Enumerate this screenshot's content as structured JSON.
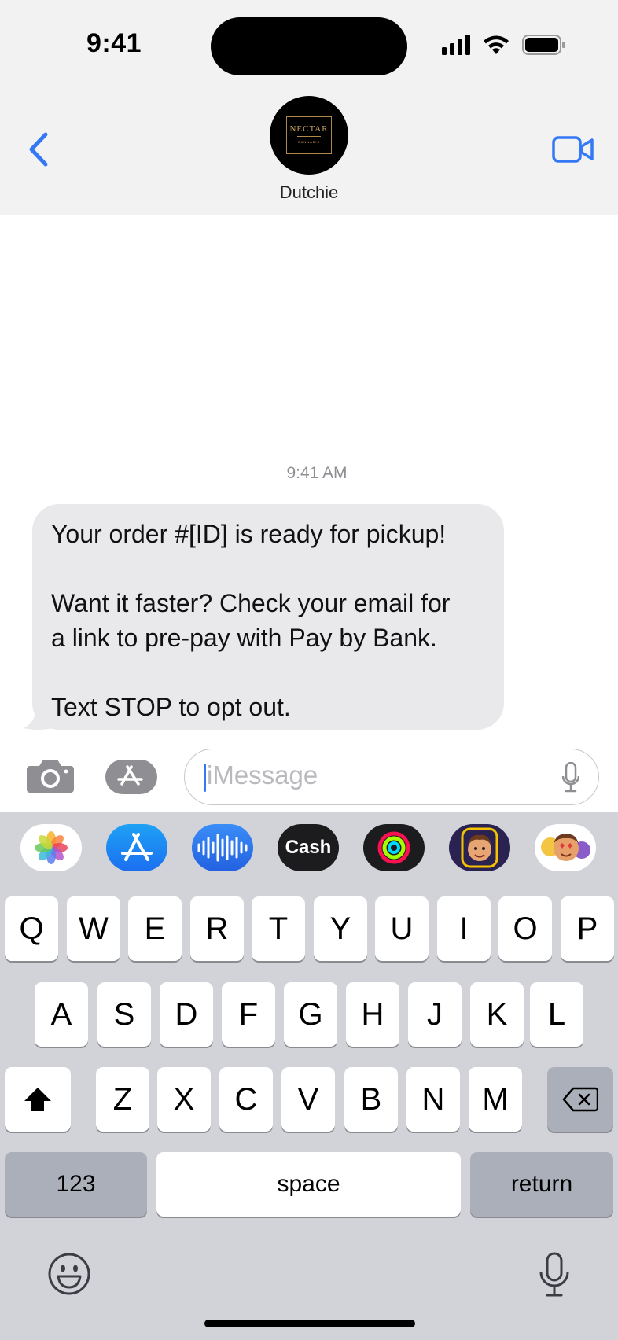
{
  "status_bar": {
    "time": "9:41"
  },
  "header": {
    "contact_name": "Dutchie",
    "avatar_brand": "NECTAR",
    "avatar_sub": "CANNABIS"
  },
  "messages": {
    "timestamp": "9:41 AM",
    "incoming": [
      {
        "lines": [
          "Your order #[ID] is ready for pickup!",
          "",
          "Want it faster? Check your email for",
          "a link to pre-pay with Pay by Bank.",
          "",
          "Text STOP to opt out."
        ]
      }
    ]
  },
  "composer": {
    "placeholder": "iMessage"
  },
  "app_strip": [
    {
      "name": "photos-app-icon"
    },
    {
      "name": "app-store-icon"
    },
    {
      "name": "audio-message-icon"
    },
    {
      "name": "apple-cash-icon",
      "label": "Cash"
    },
    {
      "name": "activity-icon"
    },
    {
      "name": "memoji-icon"
    },
    {
      "name": "memoji-stickers-icon"
    }
  ],
  "keyboard": {
    "row1": [
      "Q",
      "W",
      "E",
      "R",
      "T",
      "Y",
      "U",
      "I",
      "O",
      "P"
    ],
    "row2": [
      "A",
      "S",
      "D",
      "F",
      "G",
      "H",
      "J",
      "K",
      "L"
    ],
    "row3": [
      "Z",
      "X",
      "C",
      "V",
      "B",
      "N",
      "M"
    ],
    "numbers_label": "123",
    "space_label": "space",
    "return_label": "return"
  },
  "colors": {
    "accent": "#3478f6",
    "bubble": "#e9e9eb",
    "keyboard_bg": "#d1d3d9"
  }
}
